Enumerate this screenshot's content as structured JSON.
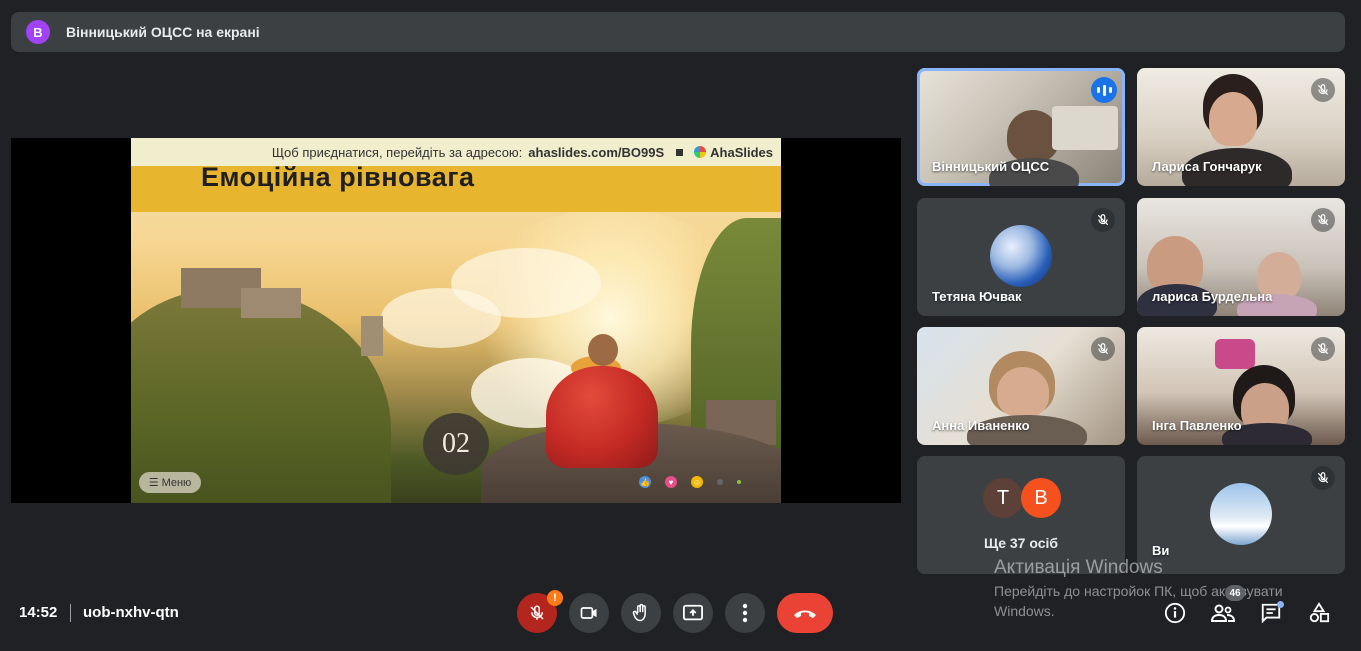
{
  "presenting_bar": {
    "avatar_letter": "В",
    "label": "Вінницький ОЦСС на екрані"
  },
  "slide": {
    "join_text": "Щоб приєднатися, перейдіть за адресою:",
    "join_url": "ahaslides.com/BO99S",
    "brand": "AhaSlides",
    "title": "Емоційна рівновага",
    "badge_number": "02",
    "menu_label": "Меню"
  },
  "participants": [
    {
      "name": "Вінницький ОЦСС",
      "state": "speaking"
    },
    {
      "name": "Лариса Гончарук",
      "state": "muted"
    },
    {
      "name": "Тетяна Ючвак",
      "state": "muted"
    },
    {
      "name": "лариса Бурдельна",
      "state": "muted"
    },
    {
      "name": "Анна Иваненко",
      "state": "muted"
    },
    {
      "name": "Інга Павленко",
      "state": "muted"
    },
    {
      "name": "Ви",
      "state": "muted"
    }
  ],
  "more_tile": {
    "letters": [
      "Т",
      "В"
    ],
    "label": "Ще 37 осіб"
  },
  "watermark": {
    "title": "Активація Windows",
    "subtitle": "Перейдіть до настройок ПК, щоб активувати Windows."
  },
  "bottom_bar": {
    "time": "14:52",
    "meeting_code": "uob-nxhv-qtn",
    "mic_alert": "!",
    "people_count": "46"
  },
  "colors": {
    "background": "#202124",
    "tile": "#3c4043",
    "accent_blue": "#1a73e8",
    "danger_red": "#ea4335",
    "alert_orange": "#fa7b17",
    "slide_header": "#e7b62e"
  }
}
